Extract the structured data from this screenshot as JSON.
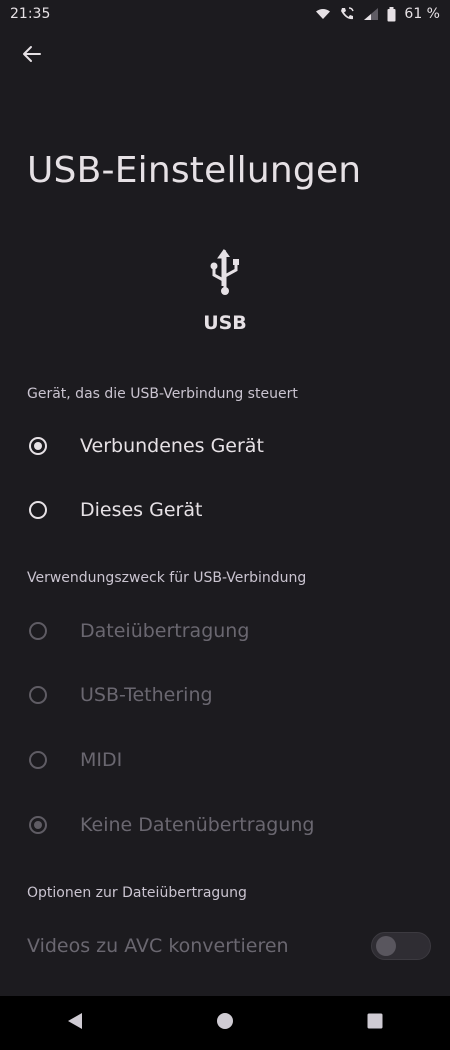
{
  "status_bar": {
    "time": "21:35",
    "battery": "61 %",
    "icons": [
      "wifi-icon",
      "phone-wifi-icon",
      "signal-icon",
      "battery-icon"
    ]
  },
  "page": {
    "title": "USB-Einstellungen",
    "usb_label": "USB"
  },
  "sections": {
    "control": {
      "header": "Gerät, das die USB-Verbindung steuert",
      "options": [
        {
          "label": "Verbundenes Gerät",
          "checked": true,
          "disabled": false
        },
        {
          "label": "Dieses Gerät",
          "checked": false,
          "disabled": false
        }
      ]
    },
    "purpose": {
      "header": "Verwendungszweck für USB-Verbindung",
      "options": [
        {
          "label": "Dateiübertragung",
          "checked": false,
          "disabled": true
        },
        {
          "label": "USB-Tethering",
          "checked": false,
          "disabled": true
        },
        {
          "label": "MIDI",
          "checked": false,
          "disabled": true
        },
        {
          "label": "Keine Datenübertragung",
          "checked": true,
          "disabled": true
        }
      ]
    },
    "file_options": {
      "header": "Optionen zur Dateiübertragung",
      "toggle_label": "Videos zu AVC konvertieren",
      "toggle_on": false
    }
  },
  "colors": {
    "background": "#1c1b1f",
    "text": "#e6e1e5",
    "disabled": "#6a6770"
  }
}
